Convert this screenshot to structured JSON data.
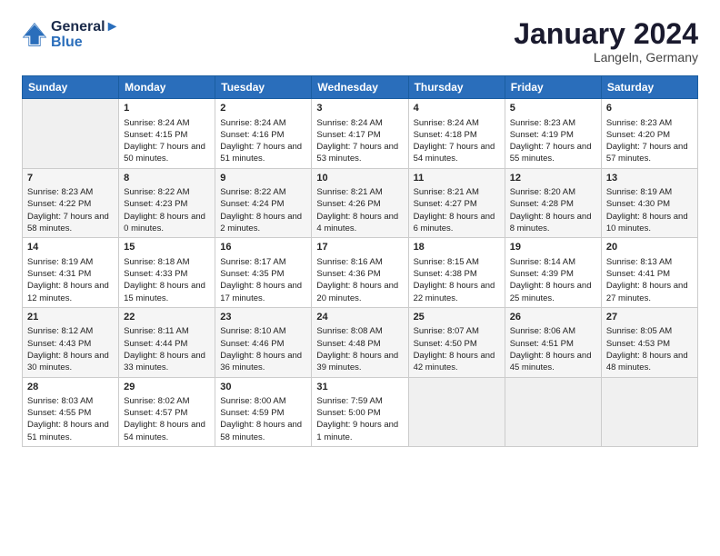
{
  "header": {
    "logo_line1": "General",
    "logo_line2": "Blue",
    "month": "January 2024",
    "location": "Langeln, Germany"
  },
  "days_of_week": [
    "Sunday",
    "Monday",
    "Tuesday",
    "Wednesday",
    "Thursday",
    "Friday",
    "Saturday"
  ],
  "weeks": [
    [
      {
        "day": "",
        "sunrise": "",
        "sunset": "",
        "daylight": ""
      },
      {
        "day": "1",
        "sunrise": "Sunrise: 8:24 AM",
        "sunset": "Sunset: 4:15 PM",
        "daylight": "Daylight: 7 hours and 50 minutes."
      },
      {
        "day": "2",
        "sunrise": "Sunrise: 8:24 AM",
        "sunset": "Sunset: 4:16 PM",
        "daylight": "Daylight: 7 hours and 51 minutes."
      },
      {
        "day": "3",
        "sunrise": "Sunrise: 8:24 AM",
        "sunset": "Sunset: 4:17 PM",
        "daylight": "Daylight: 7 hours and 53 minutes."
      },
      {
        "day": "4",
        "sunrise": "Sunrise: 8:24 AM",
        "sunset": "Sunset: 4:18 PM",
        "daylight": "Daylight: 7 hours and 54 minutes."
      },
      {
        "day": "5",
        "sunrise": "Sunrise: 8:23 AM",
        "sunset": "Sunset: 4:19 PM",
        "daylight": "Daylight: 7 hours and 55 minutes."
      },
      {
        "day": "6",
        "sunrise": "Sunrise: 8:23 AM",
        "sunset": "Sunset: 4:20 PM",
        "daylight": "Daylight: 7 hours and 57 minutes."
      }
    ],
    [
      {
        "day": "7",
        "sunrise": "Sunrise: 8:23 AM",
        "sunset": "Sunset: 4:22 PM",
        "daylight": "Daylight: 7 hours and 58 minutes."
      },
      {
        "day": "8",
        "sunrise": "Sunrise: 8:22 AM",
        "sunset": "Sunset: 4:23 PM",
        "daylight": "Daylight: 8 hours and 0 minutes."
      },
      {
        "day": "9",
        "sunrise": "Sunrise: 8:22 AM",
        "sunset": "Sunset: 4:24 PM",
        "daylight": "Daylight: 8 hours and 2 minutes."
      },
      {
        "day": "10",
        "sunrise": "Sunrise: 8:21 AM",
        "sunset": "Sunset: 4:26 PM",
        "daylight": "Daylight: 8 hours and 4 minutes."
      },
      {
        "day": "11",
        "sunrise": "Sunrise: 8:21 AM",
        "sunset": "Sunset: 4:27 PM",
        "daylight": "Daylight: 8 hours and 6 minutes."
      },
      {
        "day": "12",
        "sunrise": "Sunrise: 8:20 AM",
        "sunset": "Sunset: 4:28 PM",
        "daylight": "Daylight: 8 hours and 8 minutes."
      },
      {
        "day": "13",
        "sunrise": "Sunrise: 8:19 AM",
        "sunset": "Sunset: 4:30 PM",
        "daylight": "Daylight: 8 hours and 10 minutes."
      }
    ],
    [
      {
        "day": "14",
        "sunrise": "Sunrise: 8:19 AM",
        "sunset": "Sunset: 4:31 PM",
        "daylight": "Daylight: 8 hours and 12 minutes."
      },
      {
        "day": "15",
        "sunrise": "Sunrise: 8:18 AM",
        "sunset": "Sunset: 4:33 PM",
        "daylight": "Daylight: 8 hours and 15 minutes."
      },
      {
        "day": "16",
        "sunrise": "Sunrise: 8:17 AM",
        "sunset": "Sunset: 4:35 PM",
        "daylight": "Daylight: 8 hours and 17 minutes."
      },
      {
        "day": "17",
        "sunrise": "Sunrise: 8:16 AM",
        "sunset": "Sunset: 4:36 PM",
        "daylight": "Daylight: 8 hours and 20 minutes."
      },
      {
        "day": "18",
        "sunrise": "Sunrise: 8:15 AM",
        "sunset": "Sunset: 4:38 PM",
        "daylight": "Daylight: 8 hours and 22 minutes."
      },
      {
        "day": "19",
        "sunrise": "Sunrise: 8:14 AM",
        "sunset": "Sunset: 4:39 PM",
        "daylight": "Daylight: 8 hours and 25 minutes."
      },
      {
        "day": "20",
        "sunrise": "Sunrise: 8:13 AM",
        "sunset": "Sunset: 4:41 PM",
        "daylight": "Daylight: 8 hours and 27 minutes."
      }
    ],
    [
      {
        "day": "21",
        "sunrise": "Sunrise: 8:12 AM",
        "sunset": "Sunset: 4:43 PM",
        "daylight": "Daylight: 8 hours and 30 minutes."
      },
      {
        "day": "22",
        "sunrise": "Sunrise: 8:11 AM",
        "sunset": "Sunset: 4:44 PM",
        "daylight": "Daylight: 8 hours and 33 minutes."
      },
      {
        "day": "23",
        "sunrise": "Sunrise: 8:10 AM",
        "sunset": "Sunset: 4:46 PM",
        "daylight": "Daylight: 8 hours and 36 minutes."
      },
      {
        "day": "24",
        "sunrise": "Sunrise: 8:08 AM",
        "sunset": "Sunset: 4:48 PM",
        "daylight": "Daylight: 8 hours and 39 minutes."
      },
      {
        "day": "25",
        "sunrise": "Sunrise: 8:07 AM",
        "sunset": "Sunset: 4:50 PM",
        "daylight": "Daylight: 8 hours and 42 minutes."
      },
      {
        "day": "26",
        "sunrise": "Sunrise: 8:06 AM",
        "sunset": "Sunset: 4:51 PM",
        "daylight": "Daylight: 8 hours and 45 minutes."
      },
      {
        "day": "27",
        "sunrise": "Sunrise: 8:05 AM",
        "sunset": "Sunset: 4:53 PM",
        "daylight": "Daylight: 8 hours and 48 minutes."
      }
    ],
    [
      {
        "day": "28",
        "sunrise": "Sunrise: 8:03 AM",
        "sunset": "Sunset: 4:55 PM",
        "daylight": "Daylight: 8 hours and 51 minutes."
      },
      {
        "day": "29",
        "sunrise": "Sunrise: 8:02 AM",
        "sunset": "Sunset: 4:57 PM",
        "daylight": "Daylight: 8 hours and 54 minutes."
      },
      {
        "day": "30",
        "sunrise": "Sunrise: 8:00 AM",
        "sunset": "Sunset: 4:59 PM",
        "daylight": "Daylight: 8 hours and 58 minutes."
      },
      {
        "day": "31",
        "sunrise": "Sunrise: 7:59 AM",
        "sunset": "Sunset: 5:00 PM",
        "daylight": "Daylight: 9 hours and 1 minute."
      },
      {
        "day": "",
        "sunrise": "",
        "sunset": "",
        "daylight": ""
      },
      {
        "day": "",
        "sunrise": "",
        "sunset": "",
        "daylight": ""
      },
      {
        "day": "",
        "sunrise": "",
        "sunset": "",
        "daylight": ""
      }
    ]
  ]
}
